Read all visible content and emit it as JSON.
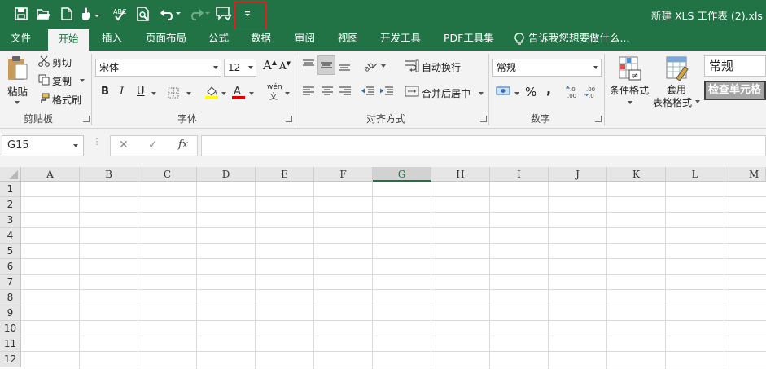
{
  "window": {
    "title": "新建 XLS 工作表 (2).xls  [",
    "accent": "#217346"
  },
  "quick_access": [
    {
      "name": "save-icon"
    },
    {
      "name": "open-icon"
    },
    {
      "name": "new-file-icon"
    },
    {
      "name": "touch-mode-icon"
    },
    {
      "name": "spelling-icon"
    },
    {
      "name": "print-preview-icon"
    },
    {
      "name": "undo-icon"
    },
    {
      "name": "redo-icon"
    },
    {
      "name": "comment-icon"
    },
    {
      "name": "customize-toolbar-icon",
      "highlighted": true
    }
  ],
  "tabs": [
    "文件",
    "开始",
    "插入",
    "页面布局",
    "公式",
    "数据",
    "审阅",
    "视图",
    "开发工具",
    "PDF工具集"
  ],
  "active_tab": "开始",
  "tell_me": "告诉我您想要做什么...",
  "ribbon": {
    "clipboard": {
      "label": "剪贴板",
      "paste": "粘贴",
      "cut": "剪切",
      "copy": "复制",
      "format_painter": "格式刷"
    },
    "font": {
      "label": "字体",
      "name": "宋体",
      "size": "12",
      "bold": "B",
      "italic": "I",
      "underline": "U",
      "increase": "A",
      "decrease": "A",
      "phonetic": "wén"
    },
    "alignment": {
      "label": "对齐方式",
      "wrap": "自动换行",
      "merge": "合并后居中"
    },
    "number": {
      "label": "数字",
      "format": "常规",
      "percent": "%",
      "comma": ","
    },
    "styles": {
      "conditional": "条件格式",
      "table_line1": "套用",
      "table_line2": "表格格式",
      "normal_style": "常规",
      "check_style": "检查单元格"
    }
  },
  "formula_bar": {
    "name_box": "G15",
    "cancel": "✕",
    "enter": "✓",
    "fx": "fx",
    "formula": ""
  },
  "sheet": {
    "columns": [
      "A",
      "B",
      "C",
      "D",
      "E",
      "F",
      "G",
      "H",
      "I",
      "J",
      "K",
      "L",
      "M"
    ],
    "selected_column": "G",
    "rows": [
      "1",
      "2",
      "3",
      "4",
      "5",
      "6",
      "7",
      "8",
      "9",
      "10",
      "11",
      "12"
    ]
  }
}
